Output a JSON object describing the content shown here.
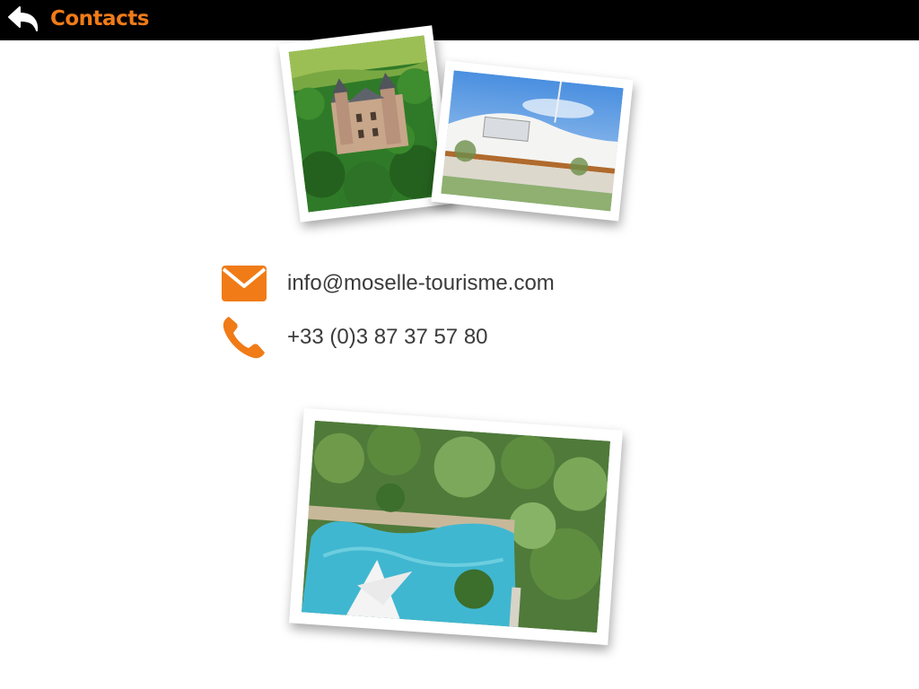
{
  "header": {
    "title": "Contacts",
    "back_icon": "back-arrow-icon",
    "title_color": "#f07b17",
    "background": "#000000"
  },
  "contacts": {
    "email": "info@moselle-tourisme.com",
    "phone": "+33 (0)3 87 37 57 80",
    "email_icon": "envelope-icon",
    "phone_icon": "phone-icon",
    "icon_color": "#f07b17",
    "text_color": "#3b3b3b"
  },
  "photos": [
    {
      "subject": "castle"
    },
    {
      "subject": "museum"
    },
    {
      "subject": "pool"
    }
  ]
}
